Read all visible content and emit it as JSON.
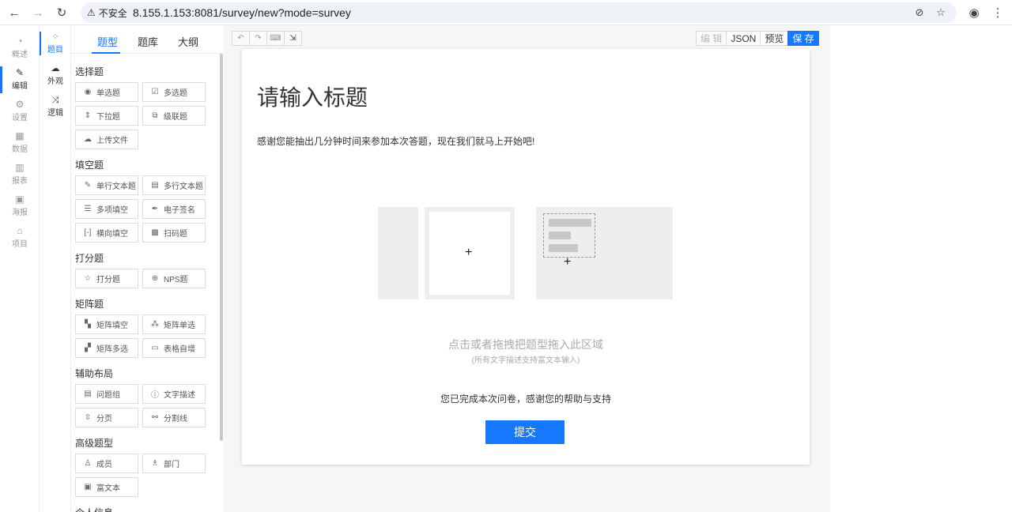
{
  "browser": {
    "security_label": "不安全",
    "url": "8.155.1.153:8081/survey/new?mode=survey"
  },
  "rail": [
    {
      "label": "概述",
      "icon": "dashboard-icon"
    },
    {
      "label": "编辑",
      "icon": "edit-icon"
    },
    {
      "label": "设置",
      "icon": "gear-icon"
    },
    {
      "label": "数据",
      "icon": "table-icon"
    },
    {
      "label": "报表",
      "icon": "bar-chart-icon"
    },
    {
      "label": "海报",
      "icon": "image-icon"
    },
    {
      "label": "项目",
      "icon": "home-icon"
    }
  ],
  "subrail": [
    {
      "label": "题目",
      "icon": "grid-icon"
    },
    {
      "label": "外观",
      "icon": "palette-icon"
    },
    {
      "label": "逻辑",
      "icon": "shuffle-icon"
    }
  ],
  "panel_tabs": [
    "题型",
    "题库",
    "大纲"
  ],
  "groups": [
    {
      "title": "选择题",
      "items": [
        {
          "label": "单选题",
          "icon": "radio-icon"
        },
        {
          "label": "多选题",
          "icon": "checkbox-icon"
        },
        {
          "label": "下拉题",
          "icon": "sort-icon"
        },
        {
          "label": "级联题",
          "icon": "cascade-icon"
        },
        {
          "label": "上传文件",
          "icon": "upload-icon"
        }
      ]
    },
    {
      "title": "填空题",
      "items": [
        {
          "label": "单行文本题",
          "icon": "pencil-icon"
        },
        {
          "label": "多行文本题",
          "icon": "textarea-icon"
        },
        {
          "label": "多项填空",
          "icon": "multi-blank-icon"
        },
        {
          "label": "电子签名",
          "icon": "signature-icon"
        },
        {
          "label": "横向填空",
          "icon": "bracket-icon"
        },
        {
          "label": "扫码题",
          "icon": "qrcode-icon"
        }
      ]
    },
    {
      "title": "打分题",
      "items": [
        {
          "label": "打分题",
          "icon": "star-icon"
        },
        {
          "label": "NPS题",
          "icon": "nps-icon"
        }
      ]
    },
    {
      "title": "矩阵题",
      "items": [
        {
          "label": "矩阵填空",
          "icon": "matrix-icon"
        },
        {
          "label": "矩阵单选",
          "icon": "matrix-radio-icon"
        },
        {
          "label": "矩阵多选",
          "icon": "matrix-check-icon"
        },
        {
          "label": "表格自增",
          "icon": "table-add-icon"
        }
      ]
    },
    {
      "title": "辅助布局",
      "items": [
        {
          "label": "问题组",
          "icon": "group-icon"
        },
        {
          "label": "文字描述",
          "icon": "info-icon"
        },
        {
          "label": "分页",
          "icon": "page-break-icon"
        },
        {
          "label": "分割线",
          "icon": "divider-icon"
        }
      ]
    },
    {
      "title": "高级题型",
      "items": [
        {
          "label": "成员",
          "icon": "user-icon"
        },
        {
          "label": "部门",
          "icon": "org-icon"
        },
        {
          "label": "富文本",
          "icon": "richtext-icon"
        }
      ]
    },
    {
      "title": "个人信息",
      "items": []
    }
  ],
  "toolbar": {
    "undo": "↶",
    "redo": "↷",
    "keyboard": "⌨",
    "export": "⇲"
  },
  "actions": {
    "edit": "编 辑",
    "json": "JSON",
    "preview": "预览",
    "save": "保 存"
  },
  "survey": {
    "title": "请输入标题",
    "description": "感谢您能抽出几分钟时间来参加本次答题，现在我们就马上开始吧!",
    "drop_hint": "点击或者拖拽把题型拖入此区域",
    "drop_sub": "(所有文字描述支持富文本输入)",
    "finish_text": "您已完成本次问卷，感谢您的帮助与支持",
    "submit_label": "提交"
  }
}
